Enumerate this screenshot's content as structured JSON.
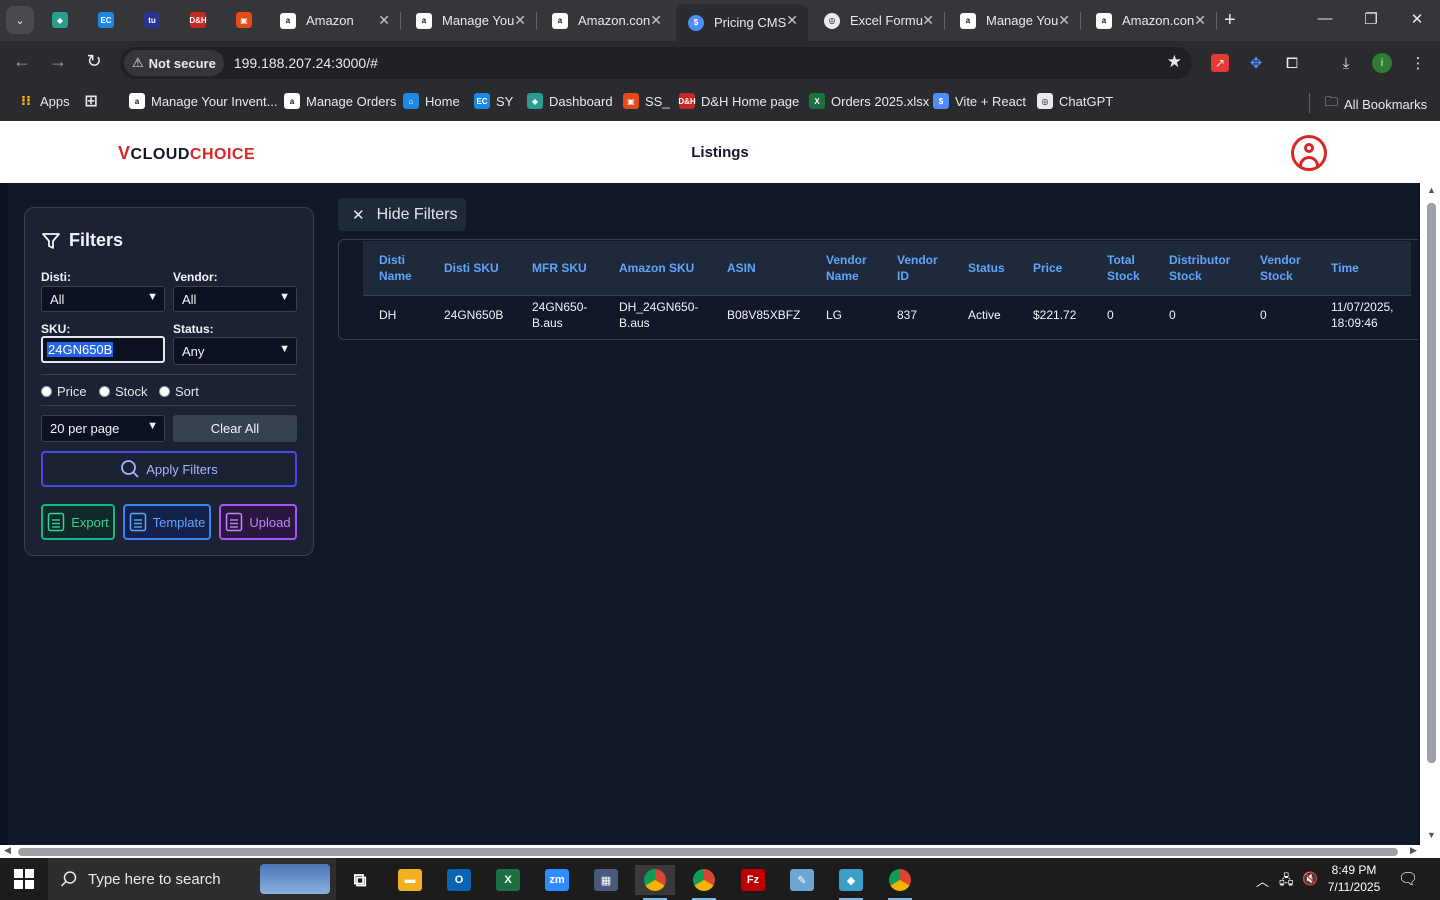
{
  "browser": {
    "tabs": [
      {
        "title": "Amazon",
        "icon": "amazon-icon"
      },
      {
        "title": "Manage You",
        "icon": "amazon-icon"
      },
      {
        "title": "Amazon.con",
        "icon": "amazon-icon"
      },
      {
        "title": "Pricing CMS",
        "icon": "dollar-icon",
        "active": true
      },
      {
        "title": "Excel Formu",
        "icon": "chatgpt-icon"
      },
      {
        "title": "Manage You",
        "icon": "amazon-icon"
      },
      {
        "title": "Amazon.con",
        "icon": "amazon-icon"
      }
    ],
    "pinned_tabs": [
      {
        "icon": "diamond-icon",
        "glyph": "◆",
        "color": "#2a9d8f"
      },
      {
        "icon": "ec-icon",
        "glyph": "EC",
        "color": "#1e88e5"
      },
      {
        "icon": "tu-icon",
        "glyph": "tu",
        "color": "#283593"
      },
      {
        "icon": "dh-icon",
        "glyph": "D&H",
        "color": "#c62828"
      },
      {
        "icon": "box-icon",
        "glyph": "▣",
        "color": "#e64a19"
      }
    ],
    "security_label": "Not secure",
    "url": "199.188.207.24:3000/#",
    "bookmarks": [
      {
        "label": "Apps",
        "icon": "apps-icon"
      },
      {
        "label": "",
        "icon": "grid-icon"
      },
      {
        "label": "Manage Your Invent...",
        "icon": "amazon-icon"
      },
      {
        "label": "Manage Orders",
        "icon": "amazon-icon"
      },
      {
        "label": "Home",
        "icon": "home-app-icon"
      },
      {
        "label": "SY",
        "icon": "ec-icon"
      },
      {
        "label": "Dashboard",
        "icon": "diamond-icon"
      },
      {
        "label": "SS_",
        "icon": "box-icon"
      },
      {
        "label": "D&H Home page",
        "icon": "dh-icon"
      },
      {
        "label": "Orders 2025.xlsx",
        "icon": "excel-icon"
      },
      {
        "label": "Vite + React",
        "icon": "dollar-icon"
      },
      {
        "label": "ChatGPT",
        "icon": "chatgpt-icon"
      }
    ],
    "all_bookmarks": "All Bookmarks"
  },
  "app": {
    "logo_prefix": "V",
    "logo_cloud": "CLOUD",
    "logo_choice": "CHOICE",
    "page_title": "Listings"
  },
  "filters": {
    "title": "Filters",
    "disti_label": "Disti:",
    "disti_value": "All",
    "vendor_label": "Vendor:",
    "vendor_value": "All",
    "sku_label": "SKU:",
    "sku_value": "24GN650B",
    "status_label": "Status:",
    "status_value": "Any",
    "radios": [
      "Price",
      "Stock",
      "Sort"
    ],
    "per_page": "20 per page",
    "clear_all": "Clear All",
    "apply": "Apply Filters",
    "export": "Export",
    "template": "Template",
    "upload": "Upload",
    "hide_filters": "Hide Filters"
  },
  "table": {
    "columns": [
      [
        "Disti",
        "Name"
      ],
      [
        "Disti SKU"
      ],
      [
        "MFR SKU"
      ],
      [
        "Amazon SKU"
      ],
      [
        "ASIN"
      ],
      [
        "Vendor",
        "Name"
      ],
      [
        "Vendor",
        "ID"
      ],
      [
        "Status"
      ],
      [
        "Price"
      ],
      [
        "Total",
        "Stock"
      ],
      [
        "Distributor",
        "Stock"
      ],
      [
        "Vendor",
        "Stock"
      ],
      [
        "Time"
      ]
    ],
    "rows": [
      [
        [
          "DH"
        ],
        [
          "24GN650B"
        ],
        [
          "24GN650-",
          "B.aus"
        ],
        [
          "DH_24GN650-",
          "B.aus"
        ],
        [
          "B08V85XBFZ"
        ],
        [
          "LG"
        ],
        [
          "837"
        ],
        [
          "Active"
        ],
        [
          "$221.72"
        ],
        [
          "0"
        ],
        [
          "0"
        ],
        [
          "0"
        ],
        [
          "11/07/2025,",
          "18:09:46"
        ]
      ]
    ]
  },
  "taskbar": {
    "search_placeholder": "Type here to search",
    "time": "8:49 PM",
    "date": "7/11/2025",
    "apps": [
      {
        "name": "task-view-icon",
        "glyph": "⧉",
        "color": "transparent"
      },
      {
        "name": "file-explorer-icon",
        "glyph": "▬",
        "color": "#f2b01e"
      },
      {
        "name": "outlook-icon",
        "glyph": "O",
        "color": "#0a64b4"
      },
      {
        "name": "excel-icon",
        "glyph": "X",
        "color": "#1d7044"
      },
      {
        "name": "zoom-icon",
        "glyph": "zm",
        "color": "#2d8cff"
      },
      {
        "name": "calculator-icon",
        "glyph": "▦",
        "color": "#4a5a7a"
      },
      {
        "name": "chrome-icon",
        "glyph": "●",
        "color": "#db4437",
        "running": true
      },
      {
        "name": "chrome-icon",
        "glyph": "●",
        "color": "#db4437",
        "running": true
      },
      {
        "name": "filezilla-icon",
        "glyph": "Fz",
        "color": "#bf0000"
      },
      {
        "name": "notepad-icon",
        "glyph": "✎",
        "color": "#6aa6d6"
      },
      {
        "name": "diamond-app-icon",
        "glyph": "◆",
        "color": "#3aa0c8",
        "running": true
      },
      {
        "name": "chrome-profile-icon",
        "glyph": "●",
        "color": "#db4437",
        "running": true
      }
    ]
  }
}
